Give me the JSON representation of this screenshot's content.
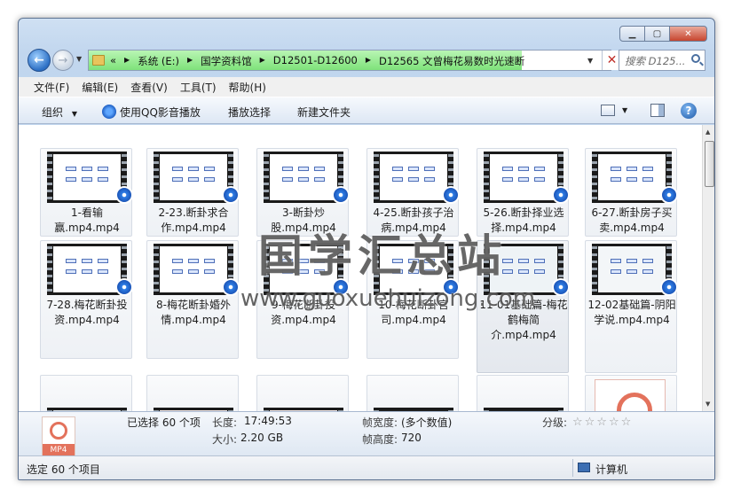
{
  "navigation": {
    "crumbs": [
      "«",
      "系统 (E:)",
      "国学资料馆",
      "D12501-D12600",
      "D12565 文曾梅花易数时光速断"
    ],
    "search_placeholder": "搜索 D125..."
  },
  "menu": [
    "文件(F)",
    "编辑(E)",
    "查看(V)",
    "工具(T)",
    "帮助(H)"
  ],
  "toolbar": {
    "organize": "组织",
    "play_qq": "使用QQ影音播放",
    "play_selection": "播放选择",
    "new_folder": "新建文件夹"
  },
  "files": [
    {
      "label": "1-看输赢.mp4.mp4"
    },
    {
      "label": "2-23.断卦求合作.mp4.mp4"
    },
    {
      "label": "3-断卦炒股.mp4.mp4"
    },
    {
      "label": "4-25.断卦孩子治病.mp4.mp4"
    },
    {
      "label": "5-26.断卦择业选择.mp4.mp4"
    },
    {
      "label": "6-27.断卦房子买卖.mp4.mp4"
    },
    {
      "label": "7-28.梅花断卦投资.mp4.mp4"
    },
    {
      "label": "8-梅花断卦婚外情.mp4.mp4"
    },
    {
      "label": "9-梅花断卦投资.mp4.mp4"
    },
    {
      "label": "10-梅花断卦官司.mp4.mp4"
    },
    {
      "label": "11-01基础篇-梅花鹤梅简介.mp4.mp4"
    },
    {
      "label": "12-02基础篇-阴阳学说.mp4.mp4"
    }
  ],
  "watermark": {
    "title": "国学汇总站",
    "url": "www.guoxuehuizong.com"
  },
  "details": {
    "selected": "已选择 60 个项",
    "length_label": "长度:",
    "length_value": "17:49:53",
    "size_label": "大小:",
    "size_value": "2.20 GB",
    "frame_width_label": "帧宽度:",
    "frame_width_value": "(多个数值)",
    "frame_height_label": "帧高度:",
    "frame_height_value": "720",
    "rating_label": "分级:",
    "rating_stars": "☆☆☆☆☆",
    "icon_tag": "MP4"
  },
  "status": {
    "text": "选定 60 个项目",
    "location": "计算机"
  }
}
